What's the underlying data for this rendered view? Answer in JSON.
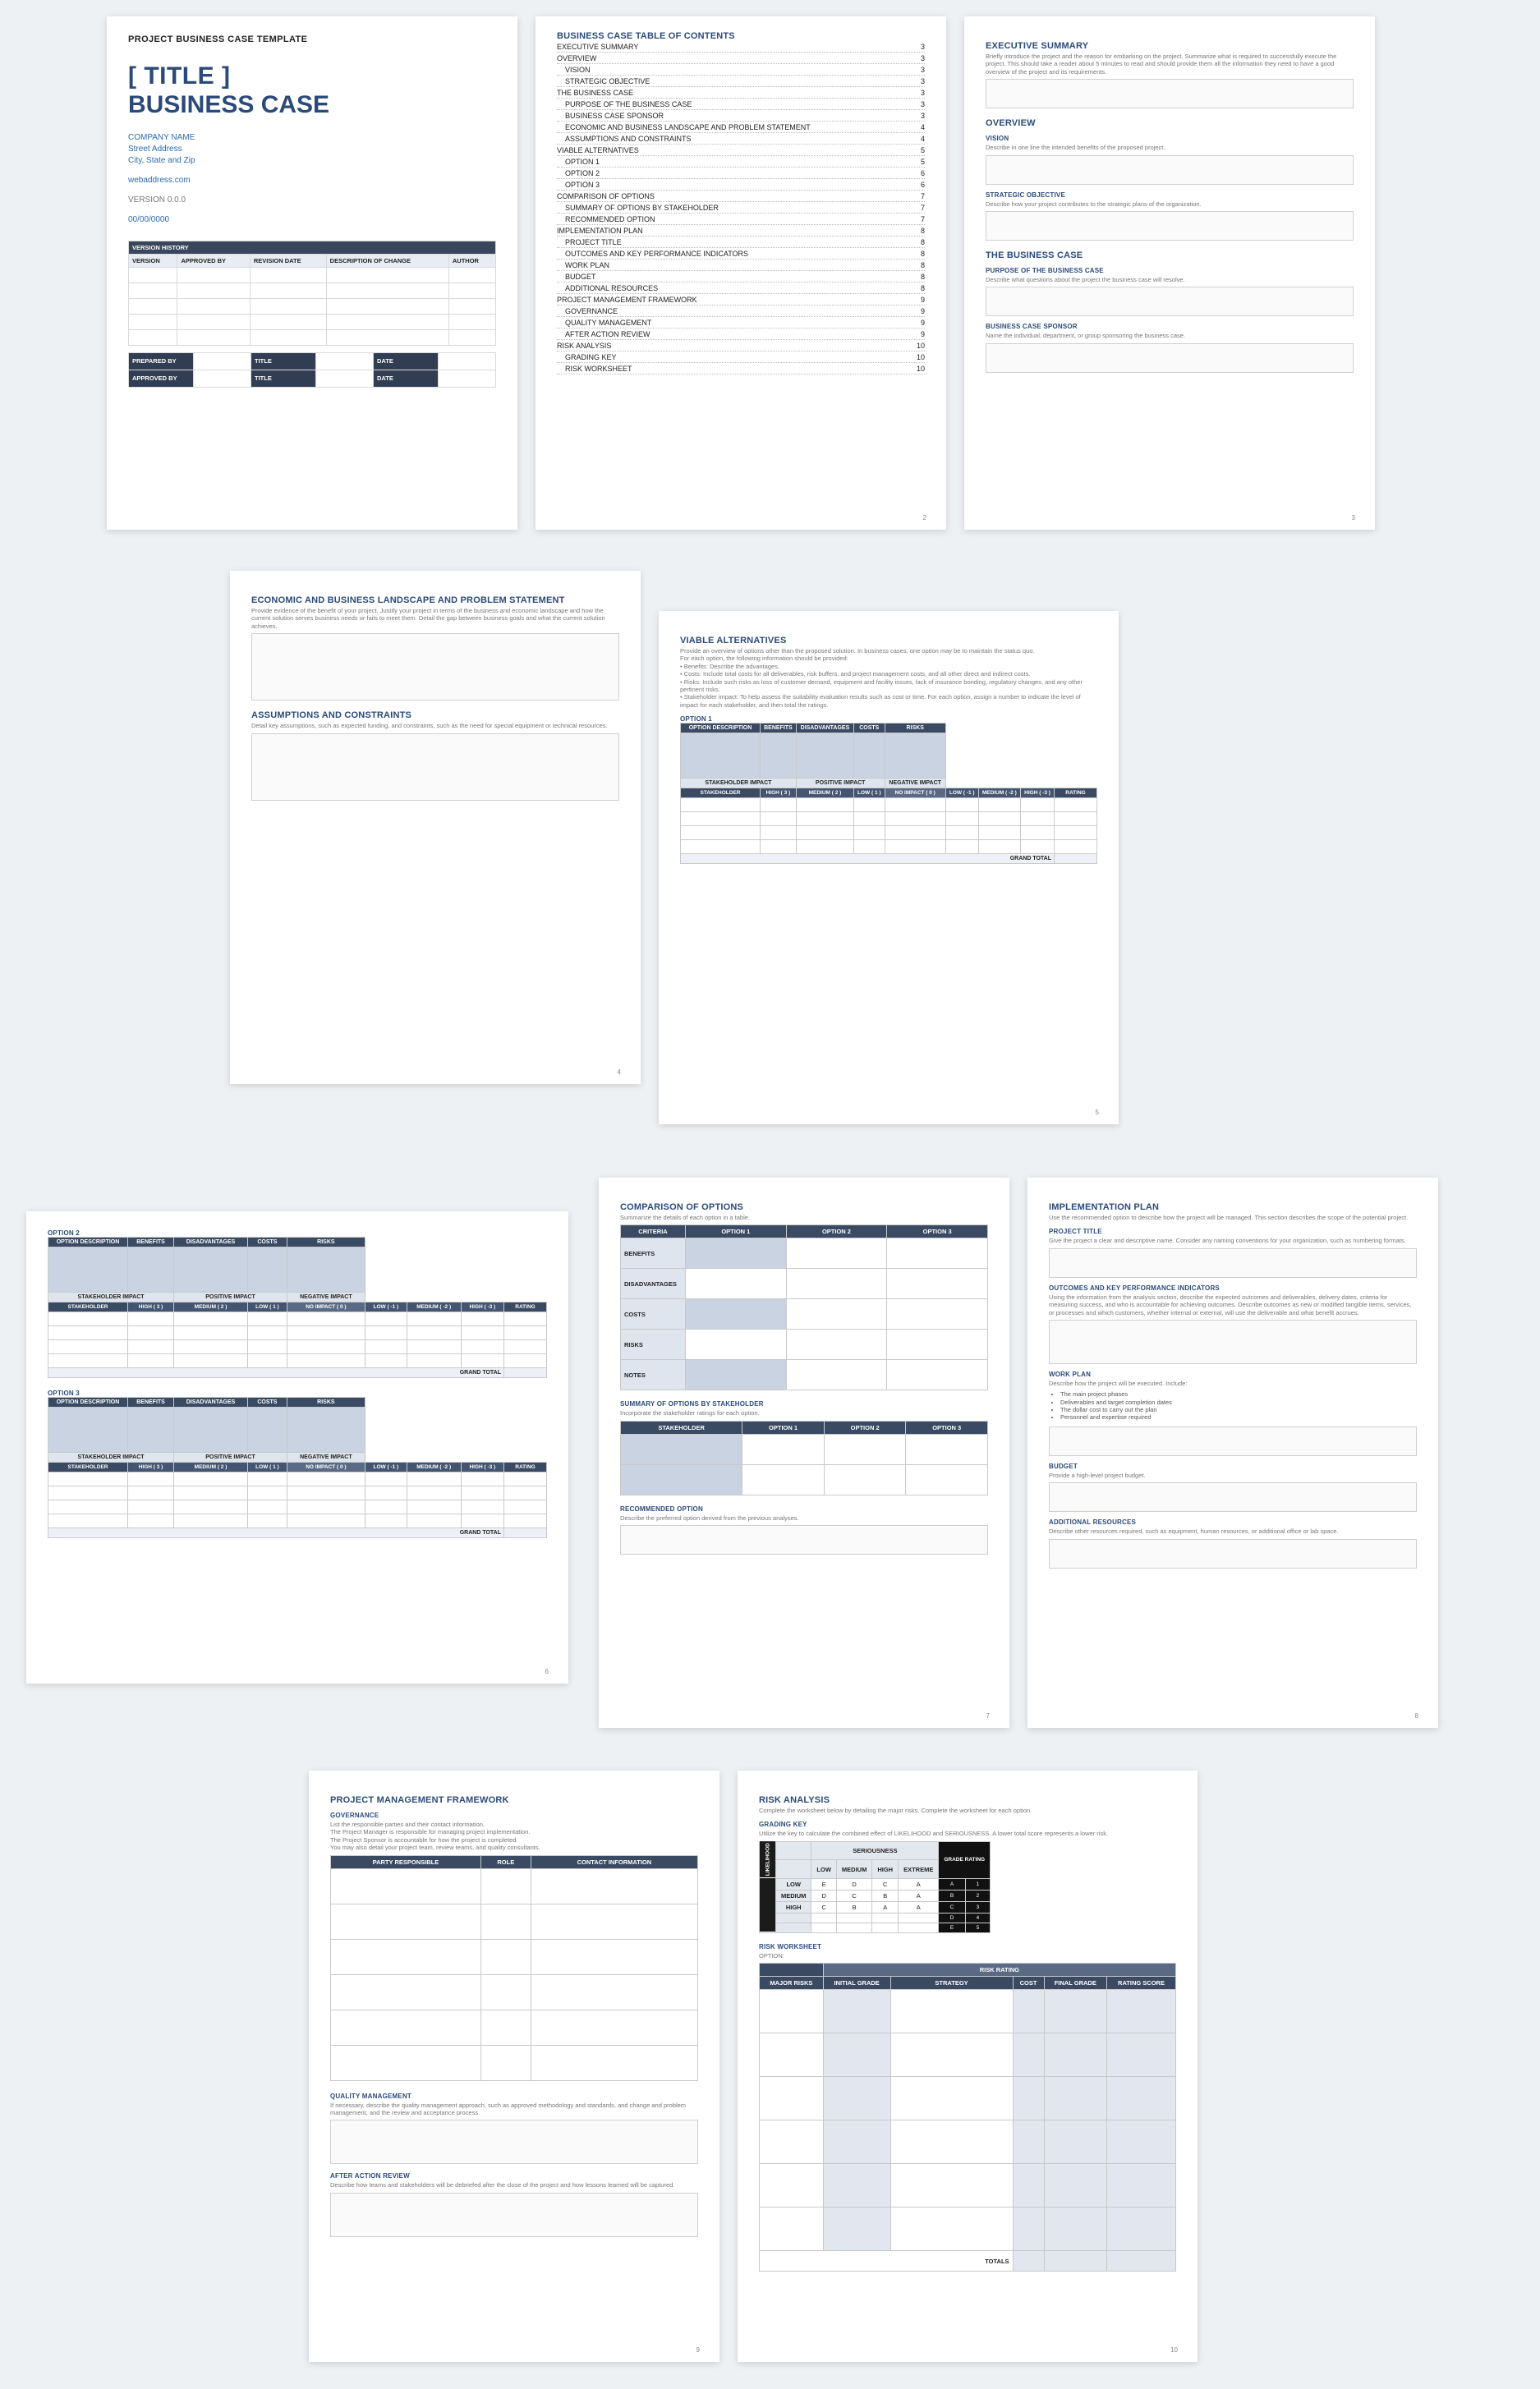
{
  "page1": {
    "kicker": "PROJECT BUSINESS CASE TEMPLATE",
    "title1": "[ TITLE ]",
    "title2": "BUSINESS CASE",
    "company": "COMPANY NAME",
    "street": "Street Address",
    "csz": "City, State and Zip",
    "url": "webaddress.com",
    "version": "VERSION 0.0.0",
    "date": "00/00/0000",
    "vh": {
      "title": "VERSION HISTORY",
      "cols": [
        "VERSION",
        "APPROVED BY",
        "REVISION DATE",
        "DESCRIPTION OF CHANGE",
        "AUTHOR"
      ]
    },
    "foot": {
      "rows": [
        [
          "PREPARED BY",
          "",
          "TITLE",
          "",
          "DATE",
          ""
        ],
        [
          "APPROVED BY",
          "",
          "TITLE",
          "",
          "DATE",
          ""
        ]
      ]
    }
  },
  "toc": {
    "title": "BUSINESS CASE TABLE OF CONTENTS",
    "items": [
      [
        "EXECUTIVE SUMMARY",
        "3",
        0
      ],
      [
        "OVERVIEW",
        "3",
        0
      ],
      [
        "VISION",
        "3",
        1
      ],
      [
        "STRATEGIC OBJECTIVE",
        "3",
        1
      ],
      [
        "THE BUSINESS CASE",
        "3",
        0
      ],
      [
        "PURPOSE OF THE BUSINESS CASE",
        "3",
        1
      ],
      [
        "BUSINESS CASE SPONSOR",
        "3",
        1
      ],
      [
        "ECONOMIC AND BUSINESS LANDSCAPE AND PROBLEM STATEMENT",
        "4",
        1
      ],
      [
        "ASSUMPTIONS AND CONSTRAINTS",
        "4",
        1
      ],
      [
        "VIABLE ALTERNATIVES",
        "5",
        0
      ],
      [
        "OPTION 1",
        "5",
        1
      ],
      [
        "OPTION 2",
        "6",
        1
      ],
      [
        "OPTION 3",
        "6",
        1
      ],
      [
        "COMPARISON OF OPTIONS",
        "7",
        0
      ],
      [
        "SUMMARY OF OPTIONS BY STAKEHOLDER",
        "7",
        1
      ],
      [
        "RECOMMENDED OPTION",
        "7",
        1
      ],
      [
        "IMPLEMENTATION PLAN",
        "8",
        0
      ],
      [
        "PROJECT TITLE",
        "8",
        1
      ],
      [
        "OUTCOMES AND KEY PERFORMANCE INDICATORS",
        "8",
        1
      ],
      [
        "WORK PLAN",
        "8",
        1
      ],
      [
        "BUDGET",
        "8",
        1
      ],
      [
        "ADDITIONAL RESOURCES",
        "8",
        1
      ],
      [
        "PROJECT MANAGEMENT FRAMEWORK",
        "9",
        0
      ],
      [
        "GOVERNANCE",
        "9",
        1
      ],
      [
        "QUALITY MANAGEMENT",
        "9",
        1
      ],
      [
        "AFTER ACTION REVIEW",
        "9",
        1
      ],
      [
        "RISK ANALYSIS",
        "10",
        0
      ],
      [
        "GRADING KEY",
        "10",
        1
      ],
      [
        "RISK WORKSHEET",
        "10",
        1
      ]
    ],
    "pageno": "2"
  },
  "page3": {
    "h1": "EXECUTIVE SUMMARY",
    "h1hint": "Briefly introduce the project and the reason for embarking on the project. Summarize what is required to successfully execute the project. This should take a reader about 5 minutes to read and should provide them all the information they need to have a good overview of the project and its requirements.",
    "over": "OVERVIEW",
    "vision": "VISION",
    "visionHint": "Describe in one line the intended benefits of the proposed project.",
    "strat": "STRATEGIC OBJECTIVE",
    "stratHint": "Describe how your project contributes to the strategic plans of the organization.",
    "tbc": "THE BUSINESS CASE",
    "purpose": "PURPOSE OF THE BUSINESS CASE",
    "purposeHint": "Describe what questions about the project the business case will resolve.",
    "sponsor": "BUSINESS CASE SPONSOR",
    "sponsorHint": "Name the individual, department, or group sponsoring the business case.",
    "pageno": "3"
  },
  "page4": {
    "h1": "ECONOMIC AND BUSINESS LANDSCAPE AND PROBLEM STATEMENT",
    "h1hint": "Provide evidence of the benefit of your project. Justify your project in terms of the business and economic landscape and how the current solution serves business needs or fails to meet them. Detail the gap between business goals and what the current solution achieves.",
    "h2": "ASSUMPTIONS AND CONSTRAINTS",
    "h2hint": "Detail key assumptions, such as expected funding, and constraints, such as the need for special equipment or technical resources.",
    "pageno": "4"
  },
  "page5": {
    "title": "VIABLE ALTERNATIVES",
    "hint": "Provide an overview of options other than the proposed solution. In business cases, one option may be to maintain the status quo.\nFor each option, the following information should be provided:\n• Benefits: Describe the advantages.\n• Costs: Include total costs for all deliverables, risk buffers, and project management costs, and all other direct and indirect costs.\n• Risks: Include such risks as loss of customer demand, equipment and facility issues, lack of insurance bonding, regulatory changes, and any other pertinent risks.\n• Stakeholder impact: To help assess the suitability evaluation results such as cost or time. For each option, assign a number to indicate the level of impact for each stakeholder, and then total the ratings.",
    "opt1": "OPTION 1",
    "optcols": [
      "OPTION DESCRIPTION",
      "BENEFITS",
      "DISADVANTAGES",
      "COSTS",
      "RISKS"
    ],
    "impact": {
      "left": "STAKEHOLDER IMPACT",
      "pos": "POSITIVE IMPACT",
      "neg": "NEGATIVE IMPACT",
      "cols": [
        "STAKEHOLDER",
        "HIGH ( 3 )",
        "MEDIUM ( 2 )",
        "LOW ( 1 )",
        "NO IMPACT ( 0 )",
        "LOW ( -1 )",
        "MEDIUM ( -2 )",
        "HIGH ( -3 )",
        "RATING"
      ],
      "grand": "GRAND TOTAL"
    },
    "pageno": "5"
  },
  "page6": {
    "opt2": "OPTION 2",
    "opt3": "OPTION 3",
    "pageno": "6"
  },
  "page7": {
    "cmp": "COMPARISON OF OPTIONS",
    "cmpHint": "Summarize the details of each option in a table.",
    "cmpCols": [
      "CRITERIA",
      "OPTION 1",
      "OPTION 2",
      "OPTION 3"
    ],
    "cmpRows": [
      "BENEFITS",
      "DISADVANTAGES",
      "COSTS",
      "RISKS",
      "NOTES"
    ],
    "sum": "SUMMARY OF OPTIONS BY STAKEHOLDER",
    "sumHint": "Incorporate the stakeholder ratings for each option.",
    "sumCols": [
      "STAKEHOLDER",
      "OPTION 1",
      "OPTION 2",
      "OPTION 3"
    ],
    "rec": "RECOMMENDED OPTION",
    "recHint": "Describe the preferred option derived from the previous analyses.",
    "pageno": "7"
  },
  "page8": {
    "title": "IMPLEMENTATION PLAN",
    "titleHint": "Use the recommended option to describe how the project will be managed. This section describes the scope of the potential project.",
    "pt": "PROJECT TITLE",
    "ptHint": "Give the project a clear and descriptive name. Consider any naming conventions for your organization, such as numbering formats.",
    "kpi": "OUTCOMES AND KEY PERFORMANCE INDICATORS",
    "kpiHint": "Using the information from the analysis section, describe the expected outcomes and deliverables, delivery dates, criteria for measuring success, and who is accountable for achieving outcomes. Describe outcomes as new or modified tangible items, services, or processes and which customers, whether internal or external, will use the deliverable and what benefit accrues.",
    "wp": "WORK PLAN",
    "wpHint": "Describe how the project will be executed. Include:",
    "wpBul": [
      "The main project phases",
      "Deliverables and target completion dates",
      "The dollar cost to carry out the plan",
      "Personnel and expertise required"
    ],
    "bud": "BUDGET",
    "budHint": "Provide a high-level project budget.",
    "ar": "ADDITIONAL RESOURCES",
    "arHint": "Describe other resources required, such as equipment, human resources, or additional office or lab space.",
    "pageno": "8"
  },
  "page9": {
    "title": "PROJECT MANAGEMENT FRAMEWORK",
    "gov": "GOVERNANCE",
    "govHint": "List the responsible parties and their contact information.\nThe Project Manager is responsible for managing project implementation.\nThe Project Sponsor is accountable for how the project is completed.\nYou may also detail your project team, review teams, and quality consultants.",
    "govCols": [
      "PARTY RESPONSIBLE",
      "ROLE",
      "CONTACT INFORMATION"
    ],
    "qm": "QUALITY MANAGEMENT",
    "qmHint": "If necessary, describe the quality management approach, such as approved methodology and standards, and change and problem management, and the review and acceptance process.",
    "aar": "AFTER ACTION REVIEW",
    "aarHint": "Describe how teams and stakeholders will be debriefed after the close of the project and how lessons learned will be captured.",
    "pageno": "9"
  },
  "page10": {
    "title": "RISK ANALYSIS",
    "titleHint": "Complete the worksheet below by detailing the major risks.  Complete the worksheet for each option.",
    "gk": "GRADING KEY",
    "gkHint": "Utilize the key to calculate the combined effect of LIKELIHOOD and SERIOUSNESS. A lower total score represents a lower risk.",
    "gkTop": "SERIOUSNESS",
    "gkSide": "LIKELIHOOD",
    "gkGrade": "GRADE   RATING",
    "gkCols": [
      "",
      "LOW",
      "MEDIUM",
      "HIGH",
      "EXTREME"
    ],
    "gkRows": [
      [
        "LOW",
        "E",
        "D",
        "C",
        "A",
        "A",
        "1"
      ],
      [
        "MEDIUM",
        "D",
        "C",
        "B",
        "A",
        "B",
        "2"
      ],
      [
        "HIGH",
        "C",
        "B",
        "A",
        "A",
        "C",
        "3"
      ],
      [
        "",
        "",
        "",
        "",
        "",
        "D",
        "4"
      ],
      [
        "",
        "",
        "",
        "",
        "",
        "E",
        "5"
      ]
    ],
    "rw": "RISK WORKSHEET",
    "rwOpt": "OPTION:",
    "rwBand": "RISK RATING",
    "rwCols": [
      "MAJOR RISKS",
      "INITIAL GRADE",
      "STRATEGY",
      "COST",
      "FINAL GRADE",
      "RATING SCORE"
    ],
    "totals": "TOTALS",
    "pageno": "10"
  }
}
